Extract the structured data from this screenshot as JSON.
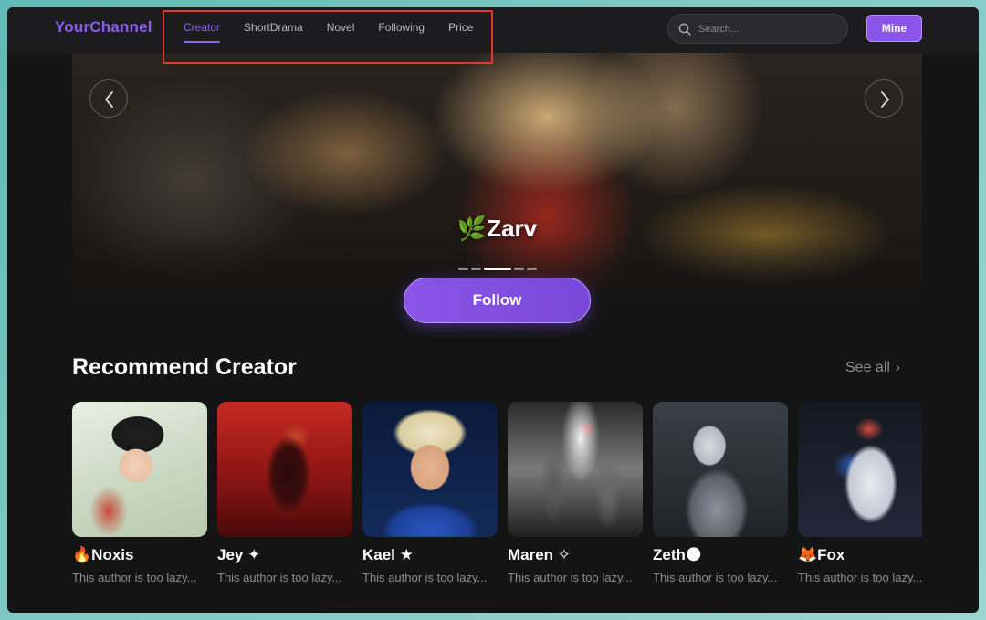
{
  "app": {
    "logo": "YourChannel"
  },
  "nav": {
    "items": [
      {
        "label": "Creator",
        "active": true
      },
      {
        "label": "ShortDrama",
        "active": false
      },
      {
        "label": "Novel",
        "active": false
      },
      {
        "label": "Following",
        "active": false
      },
      {
        "label": "Price",
        "active": false
      }
    ]
  },
  "search": {
    "placeholder": "Search...",
    "value": ""
  },
  "header": {
    "mine_label": "Mine"
  },
  "banner": {
    "title": "🌿Zarv",
    "slide_count": 5,
    "active_slide": 3,
    "follow_label": "Follow"
  },
  "section": {
    "title": "Recommend Creator",
    "see_all": "See all"
  },
  "creators": [
    {
      "name": "🔥Noxis",
      "desc": "This author is too lazy..."
    },
    {
      "name": "Jey ✦",
      "desc": "This author is too lazy..."
    },
    {
      "name": "Kael ★",
      "desc": "This author is too lazy..."
    },
    {
      "name": "Maren ✧",
      "desc": "This author is too lazy..."
    },
    {
      "name": "Zeth🌑",
      "desc": "This author is too lazy..."
    },
    {
      "name": "🦊Fox",
      "desc": "This author is too lazy..."
    }
  ],
  "colors": {
    "accent": "#8a55e8",
    "background": "#141414",
    "highlight_box": "#e0392f"
  },
  "icons": {
    "search": "search-icon",
    "prev": "chevron-left-icon",
    "next": "chevron-right-icon",
    "see_all": "chevron-right-icon"
  }
}
